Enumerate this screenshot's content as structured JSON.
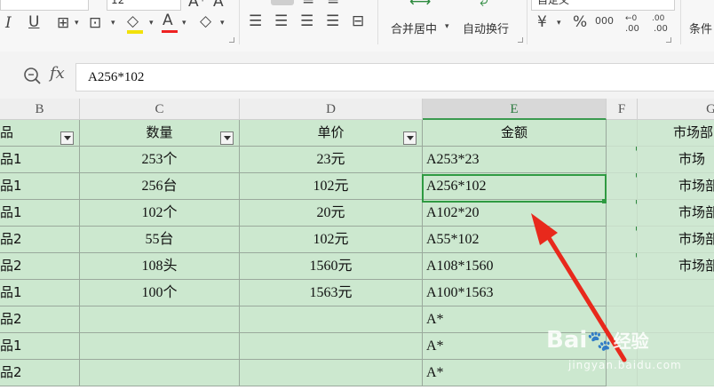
{
  "ribbon": {
    "font_size": "12",
    "alignment_group": {
      "merge_center_label": "合并居中",
      "wrap_text_label": "自动换行"
    },
    "number_group": {
      "format_value": "自定义",
      "currency_symbol": "¥",
      "percent_symbol": "%",
      "thousands_label": "000",
      "increase_decimal_label": ".00",
      "decrease_decimal_label": ".00"
    },
    "conditional_label": "条件"
  },
  "formula_bar": {
    "zoom_icon": "zoom-icon",
    "fx_label": "fx",
    "content": "A256*102"
  },
  "columns": [
    "B",
    "C",
    "D",
    "E",
    "F",
    "G"
  ],
  "table": {
    "headers": {
      "b": "品",
      "c": "数量",
      "d": "单价",
      "e": "金额",
      "g": "市场部"
    },
    "rows": [
      {
        "b": "品1",
        "c": "253个",
        "d": "23元",
        "e": "A253*23",
        "g": "市场"
      },
      {
        "b": "品1",
        "c": "256台",
        "d": "102元",
        "e": "A256*102",
        "g": "市场部"
      },
      {
        "b": "品1",
        "c": "102个",
        "d": "20元",
        "e": "A102*20",
        "g": "市场部"
      },
      {
        "b": "品2",
        "c": "55台",
        "d": "102元",
        "e": "A55*102",
        "g": "市场部"
      },
      {
        "b": "品2",
        "c": "108头",
        "d": "1560元",
        "e": "A108*1560",
        "g": "市场部"
      },
      {
        "b": "品1",
        "c": "100个",
        "d": "1563元",
        "e": "A100*1563",
        "g": ""
      },
      {
        "b": "品2",
        "c": "",
        "d": "",
        "e": "A*",
        "g": ""
      },
      {
        "b": "品1",
        "c": "",
        "d": "",
        "e": "A*",
        "g": ""
      },
      {
        "b": "品2",
        "c": "",
        "d": "",
        "e": "A*",
        "g": ""
      }
    ]
  },
  "watermark": {
    "brand": "Bai",
    "brand_cn": "经验",
    "url": "jingyan.baidu.com"
  },
  "colors": {
    "cell_fill": "#cce8cf",
    "selection": "#2f9a42",
    "arrow": "#e8291c"
  }
}
